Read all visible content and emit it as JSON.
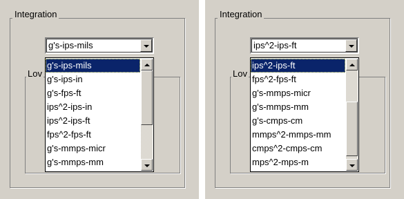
{
  "left": {
    "group_title": "Integration",
    "inner_title": "Lov",
    "combo_value": "g's-ips-mils",
    "list_items": [
      "g's-ips-mils",
      "g's-ips-in",
      "g's-fps-ft",
      "ips^2-ips-in",
      "ips^2-ips-ft",
      "fps^2-fps-ft",
      "g's-mmps-micr",
      "g's-mmps-mm"
    ],
    "selected_index": 0,
    "scroll_thumb": {
      "start": 0.0,
      "length": 0.62
    }
  },
  "right": {
    "group_title": "Integration",
    "inner_title": "Lov",
    "combo_value": "ips^2-ips-ft",
    "list_items": [
      "ips^2-ips-ft",
      "fps^2-fps-ft",
      "g's-mmps-micr",
      "g's-mmps-mm",
      "g's-cmps-cm",
      "mmps^2-mmps-mm",
      "cmps^2-cmps-cm",
      "mps^2-mps-m"
    ],
    "selected_index": 0,
    "scroll_thumb": {
      "start": 0.35,
      "length": 0.62
    }
  },
  "icons": {
    "combo_button": "chevron-down-icon",
    "scroll_up": "arrow-up-icon",
    "scroll_down": "arrow-down-icon"
  }
}
